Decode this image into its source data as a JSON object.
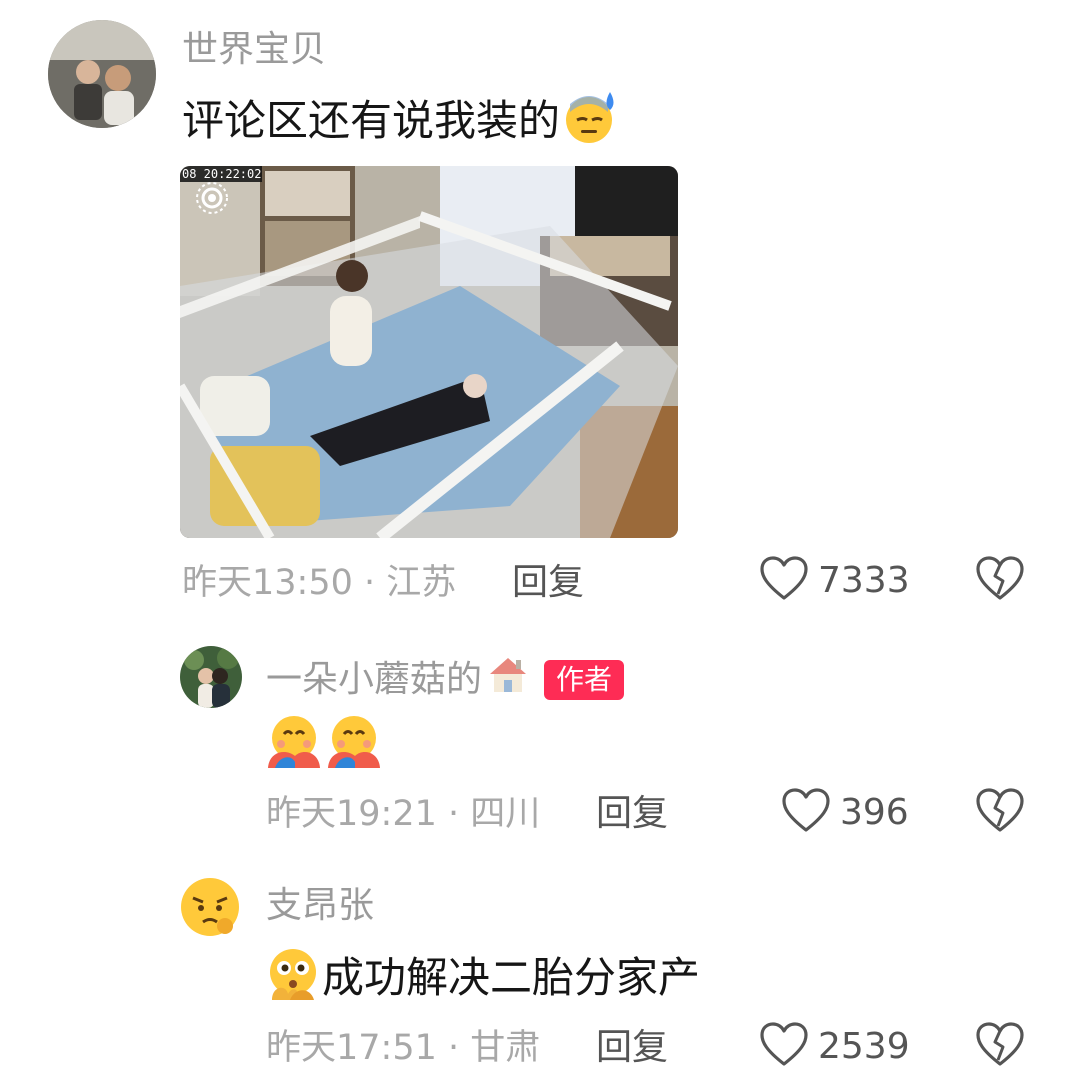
{
  "comments": [
    {
      "username": "世界宝贝",
      "text": "评论区还有说我装的",
      "text_emoji": "sweat-face",
      "photo": {
        "timestamp": "08 20:22:02"
      },
      "time_location": "昨天13:50 · 江苏",
      "reply_label": "回复",
      "like_count": "7333"
    },
    {
      "username": "一朵小蘑菇的",
      "name_emoji": "house",
      "author_badge": "作者",
      "text_emoji": "hugging-face",
      "time_location": "昨天19:21 · 四川",
      "reply_label": "回复",
      "like_count": "396"
    },
    {
      "username": "支昂张",
      "text": "成功解决二胎分家产",
      "text_emoji": "thinking-face",
      "time_location": "昨天17:51 · 甘肃",
      "reply_label": "回复",
      "like_count": "2539"
    }
  ]
}
